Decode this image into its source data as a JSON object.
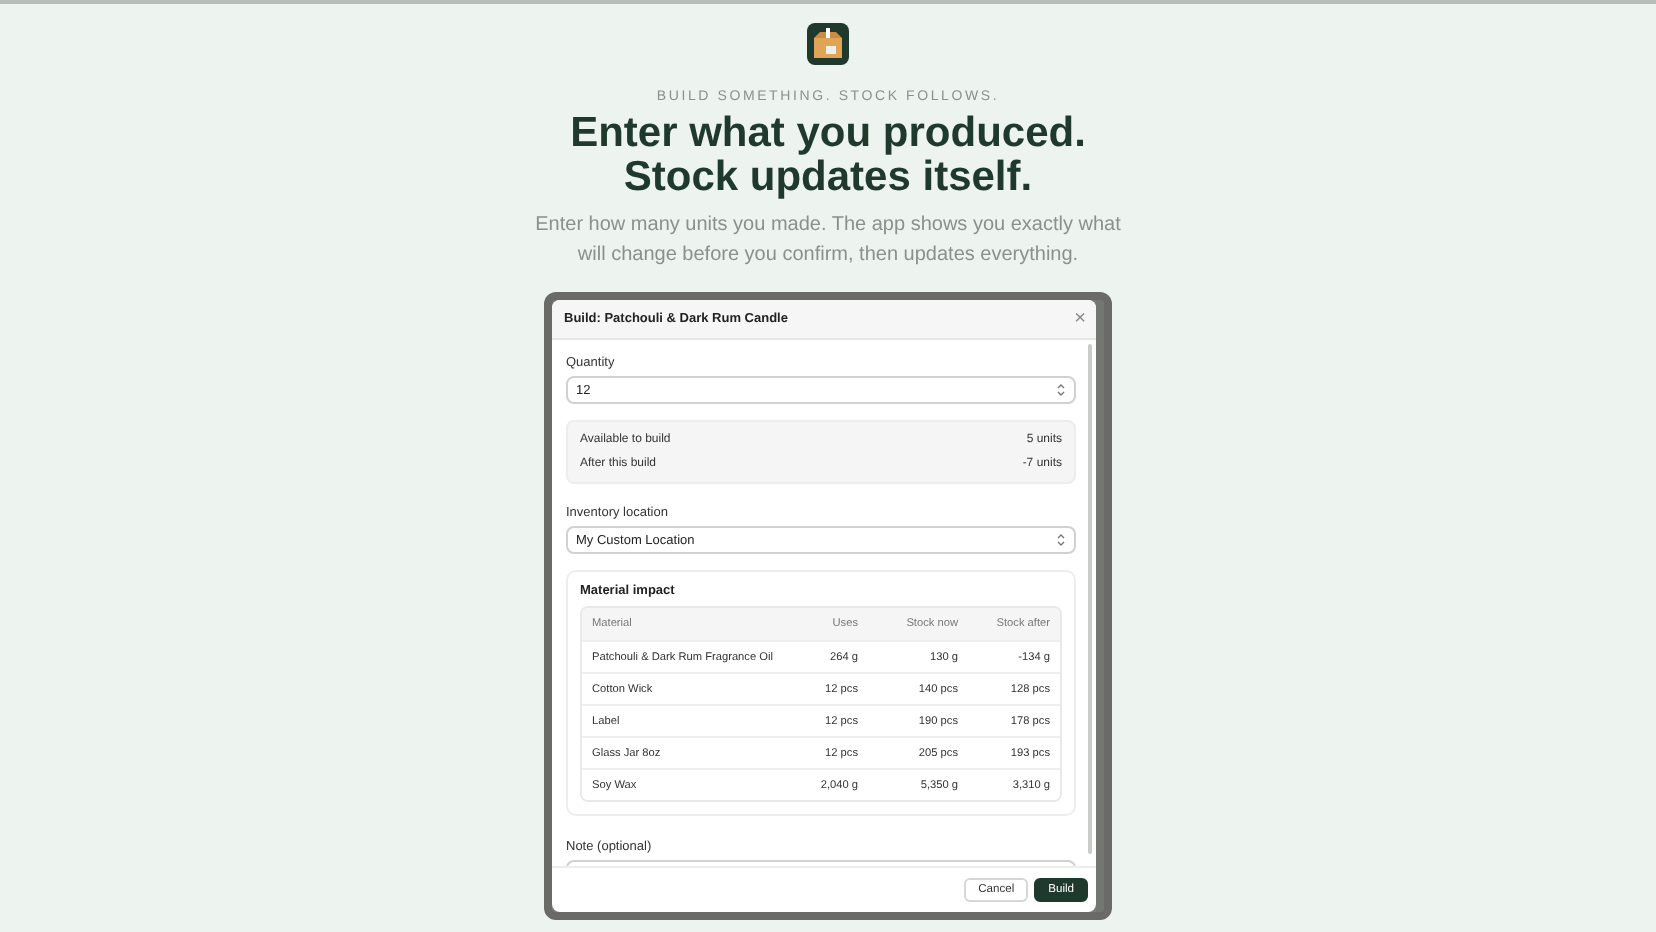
{
  "kicker": "BUILD SOMETHING. STOCK FOLLOWS.",
  "headline": [
    "Enter what you produced.",
    "Stock updates itself."
  ],
  "subtitle": "Enter how many units you made. The app shows you exactly what will change before you confirm, then updates everything.",
  "modal": {
    "title": "Build: Patchouli & Dark Rum Candle",
    "close": "×",
    "quantity": {
      "label": "Quantity",
      "value": "12"
    },
    "summary": [
      {
        "label": "Available to build",
        "value": "5 units"
      },
      {
        "label": "After this build",
        "value": "-7 units"
      }
    ],
    "location": {
      "label": "Inventory location",
      "value": "My Custom Location"
    },
    "impact": {
      "title": "Material impact",
      "columns": [
        "Material",
        "Uses",
        "Stock now",
        "Stock after"
      ],
      "rows": [
        [
          "Patchouli & Dark Rum Fragrance Oil",
          "264 g",
          "130 g",
          "-134 g"
        ],
        [
          "Cotton Wick",
          "12 pcs",
          "140 pcs",
          "128 pcs"
        ],
        [
          "Label",
          "12 pcs",
          "190 pcs",
          "178 pcs"
        ],
        [
          "Glass Jar 8oz",
          "12 pcs",
          "205 pcs",
          "193 pcs"
        ],
        [
          "Soy Wax",
          "2,040 g",
          "5,350 g",
          "3,310 g"
        ]
      ]
    },
    "note": {
      "label": "Note (optional)"
    },
    "buttons": [
      {
        "label": "Cancel",
        "kind": "secondary"
      },
      {
        "label": "Build",
        "kind": "primary"
      }
    ]
  }
}
